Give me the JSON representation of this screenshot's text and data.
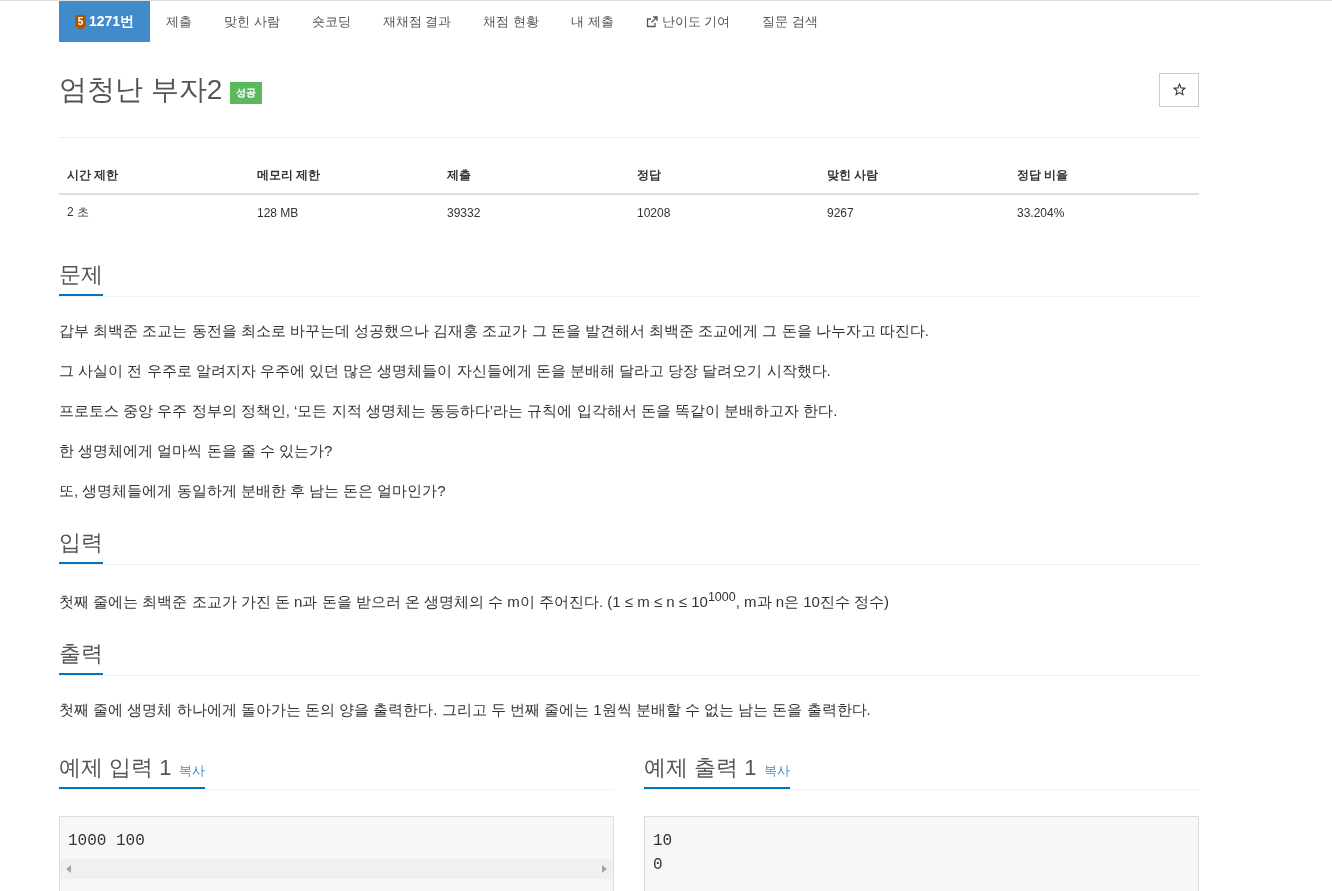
{
  "nav": [
    {
      "kind": "problem",
      "tier": "5",
      "label": "1271번",
      "selected": true
    },
    {
      "kind": "plain",
      "label": "제출",
      "selected": false
    },
    {
      "kind": "plain",
      "label": "맞힌 사람",
      "selected": false
    },
    {
      "kind": "plain",
      "label": "숏코딩",
      "selected": false
    },
    {
      "kind": "plain",
      "label": "재채점 결과",
      "selected": false
    },
    {
      "kind": "plain",
      "label": "채점 현황",
      "selected": false
    },
    {
      "kind": "plain",
      "label": "내 제출",
      "selected": false
    },
    {
      "kind": "external",
      "label": "난이도 기여",
      "selected": false
    },
    {
      "kind": "plain",
      "label": "질문 검색",
      "selected": false
    }
  ],
  "title": "엄청난 부자2",
  "status_badge": "성공",
  "starred": false,
  "stats": {
    "columns": [
      "시간 제한",
      "메모리 제한",
      "제출",
      "정답",
      "맞힌 사람",
      "정답 비율"
    ],
    "row": [
      "2 초",
      "128 MB",
      "39332",
      "10208",
      "9267",
      "33.204%"
    ]
  },
  "sections": [
    {
      "heading": "문제",
      "paragraphs": [
        "갑부 최백준 조교는 동전을 최소로 바꾸는데 성공했으나 김재홍 조교가 그 돈을 발견해서 최백준 조교에게 그 돈을 나누자고 따진다.",
        "그 사실이 전 우주로 알려지자 우주에 있던 많은 생명체들이 자신들에게 돈을 분배해 달라고 당장 달려오기 시작했다.",
        "프로토스 중앙 우주 정부의 정책인, ‘모든 지적 생명체는 동등하다’라는 규칙에 입각해서 돈을 똑같이 분배하고자 한다.",
        "한 생명체에게 얼마씩 돈을 줄 수 있는가?",
        "또, 생명체들에게 동일하게 분배한 후 남는 돈은 얼마인가?"
      ]
    },
    {
      "heading": "입력",
      "paragraphs": [
        "첫째 줄에는 최백준 조교가 가진 돈 n과 돈을 받으러 온 생명체의 수 m이 주어진다. (1 ≤ m ≤ n ≤ 10$^{1000}$, m과 n은 10진수 정수)"
      ]
    },
    {
      "heading": "출력",
      "paragraphs": [
        "첫째 줄에 생명체 하나에게 돌아가는 돈의 양을 출력한다. 그리고 두 번째 줄에는 1원씩 분배할 수 없는 남는 돈을 출력한다."
      ]
    }
  ],
  "samples": [
    {
      "heading": "예제 입력 1",
      "copy": "복사",
      "lines": [
        "1000 100"
      ],
      "scrollbar": true
    },
    {
      "heading": "예제 출력 1",
      "copy": "복사",
      "lines": [
        "10",
        "0"
      ],
      "scrollbar": false
    }
  ]
}
